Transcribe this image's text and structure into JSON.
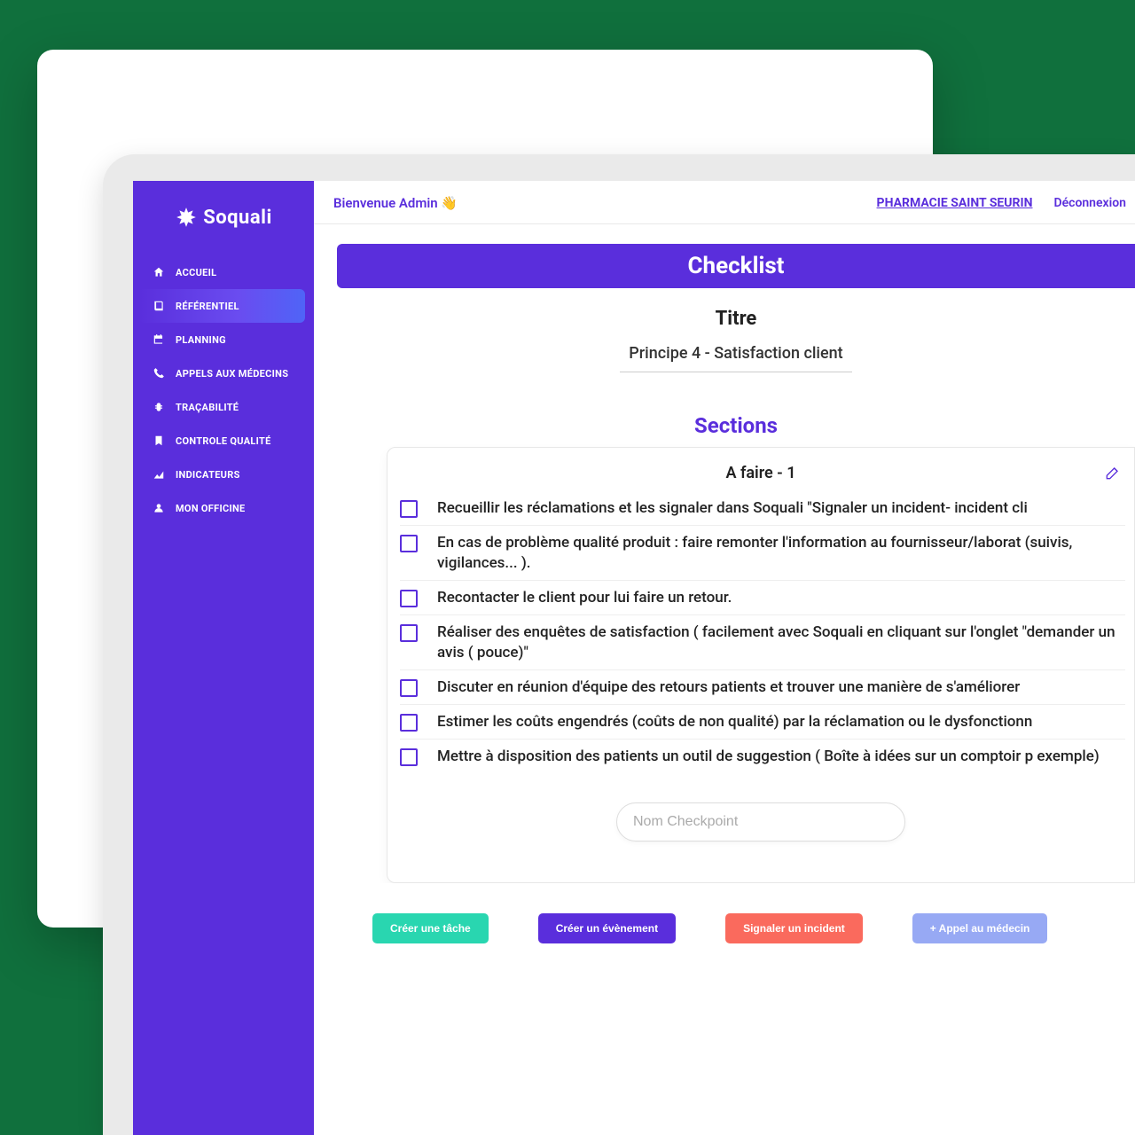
{
  "brand": "Soquali",
  "sidebar": {
    "items": [
      {
        "label": "ACCUEIL",
        "icon": "home-icon",
        "active": false
      },
      {
        "label": "RÉFÉRENTIEL",
        "icon": "book-icon",
        "active": true
      },
      {
        "label": "PLANNING",
        "icon": "calendar-icon",
        "active": false
      },
      {
        "label": "APPELS AUX MÉDECINS",
        "icon": "phone-icon",
        "active": false
      },
      {
        "label": "TRAÇABILITÉ",
        "icon": "bug-icon",
        "active": false
      },
      {
        "label": "CONTROLE QUALITÉ",
        "icon": "bookmark-icon",
        "active": false
      },
      {
        "label": "INDICATEURS",
        "icon": "chart-icon",
        "active": false
      },
      {
        "label": "MON OFFICINE",
        "icon": "user-icon",
        "active": false
      }
    ]
  },
  "topbar": {
    "welcome": "Bienvenue Admin 👋",
    "pharmacy": "PHARMACIE SAINT SEURIN",
    "logout": "Déconnexion"
  },
  "checklist": {
    "header": "Checklist",
    "title_label": "Titre",
    "title_value": "Principe 4 - Satisfaction client",
    "sections_label": "Sections",
    "section": {
      "title": "A faire - 1",
      "rows": [
        {
          "text": "Recueillir les réclamations et les signaler dans Soquali \"Signaler un incident- incident cli"
        },
        {
          "text": "En cas de problème qualité produit : faire remonter l'information au fournisseur/laborat (suivis, vigilances... )."
        },
        {
          "text": "Recontacter le client pour lui faire un retour."
        },
        {
          "text": "Réaliser des enquêtes de satisfaction ( facilement avec Soquali en cliquant sur l'onglet \"demander un avis ( pouce)\""
        },
        {
          "text": "Discuter en réunion d'équipe des retours patients et trouver une manière de s'améliorer"
        },
        {
          "text": "Estimer les coûts engendrés (coûts de non qualité) par la réclamation ou le dysfonctionn"
        },
        {
          "text": "Mettre à disposition des patients un outil de suggestion ( Boîte à idées sur un comptoir p exemple)"
        }
      ]
    },
    "checkpoint_placeholder": "Nom Checkpoint"
  },
  "actions": {
    "task": "Créer une tâche",
    "event": "Créer un évènement",
    "incident": "Signaler un incident",
    "call": "+ Appel au médecin"
  }
}
